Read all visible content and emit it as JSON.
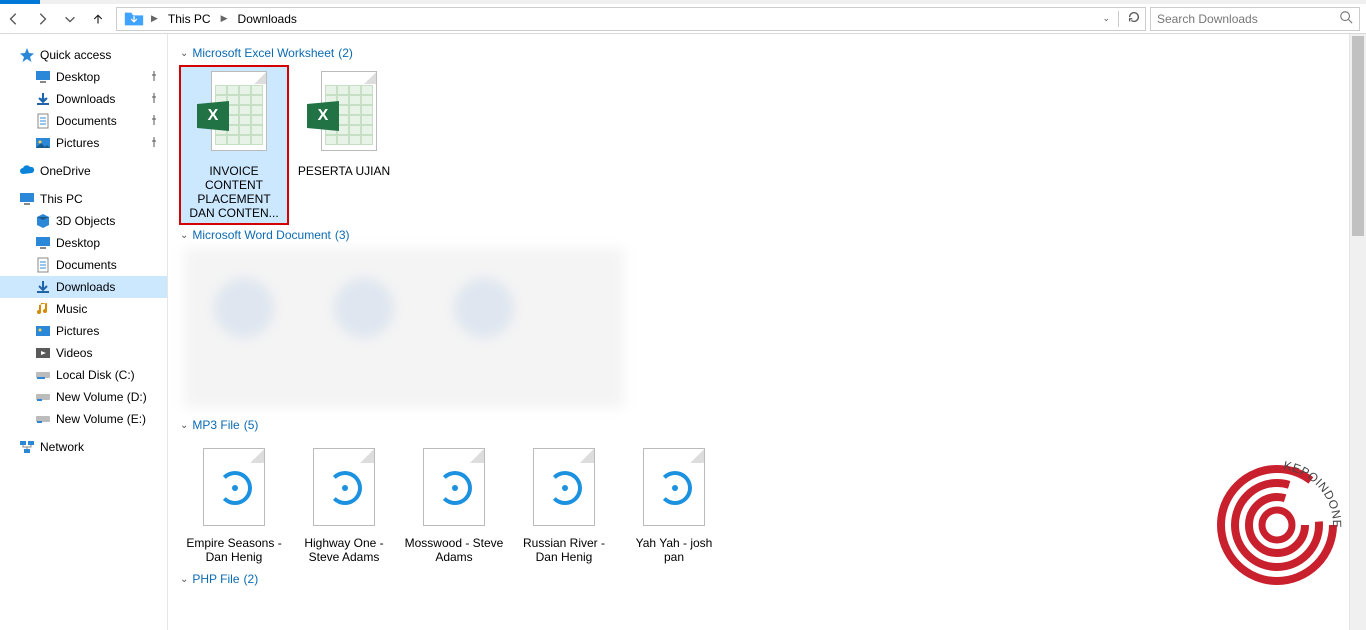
{
  "breadcrumb": {
    "segments": [
      "This PC",
      "Downloads"
    ]
  },
  "search": {
    "placeholder": "Search Downloads"
  },
  "sidebar": {
    "quick_access": {
      "label": "Quick access",
      "items": [
        {
          "label": "Desktop",
          "pinned": true,
          "icon": "desktop"
        },
        {
          "label": "Downloads",
          "pinned": true,
          "icon": "downloads"
        },
        {
          "label": "Documents",
          "pinned": true,
          "icon": "documents"
        },
        {
          "label": "Pictures",
          "pinned": true,
          "icon": "pictures"
        }
      ]
    },
    "onedrive": {
      "label": "OneDrive"
    },
    "this_pc": {
      "label": "This PC",
      "items": [
        {
          "label": "3D Objects",
          "icon": "3d"
        },
        {
          "label": "Desktop",
          "icon": "desktop"
        },
        {
          "label": "Documents",
          "icon": "documents"
        },
        {
          "label": "Downloads",
          "icon": "downloads",
          "selected": true
        },
        {
          "label": "Music",
          "icon": "music"
        },
        {
          "label": "Pictures",
          "icon": "pictures"
        },
        {
          "label": "Videos",
          "icon": "videos"
        },
        {
          "label": "Local Disk (C:)",
          "icon": "disk"
        },
        {
          "label": "New Volume (D:)",
          "icon": "disk"
        },
        {
          "label": "New Volume (E:)",
          "icon": "disk"
        }
      ]
    },
    "network": {
      "label": "Network"
    }
  },
  "groups": {
    "excel": {
      "title": "Microsoft Excel Worksheet",
      "count": "(2)",
      "files": [
        {
          "name": "INVOICE CONTENT PLACEMENT DAN CONTEN...",
          "selected": true
        },
        {
          "name": "PESERTA UJIAN",
          "selected": false
        }
      ]
    },
    "word": {
      "title": "Microsoft Word Document",
      "count": "(3)"
    },
    "mp3": {
      "title": "MP3 File",
      "count": "(5)",
      "files": [
        {
          "name": "Empire Seasons - Dan Henig"
        },
        {
          "name": "Highway One - Steve Adams"
        },
        {
          "name": "Mosswood - Steve Adams"
        },
        {
          "name": "Russian River - Dan Henig"
        },
        {
          "name": "Yah Yah - josh pan"
        }
      ]
    },
    "php": {
      "title": "PHP File",
      "count": "(2)"
    }
  },
  "watermark": {
    "text": "KEPOINDONESIA"
  }
}
